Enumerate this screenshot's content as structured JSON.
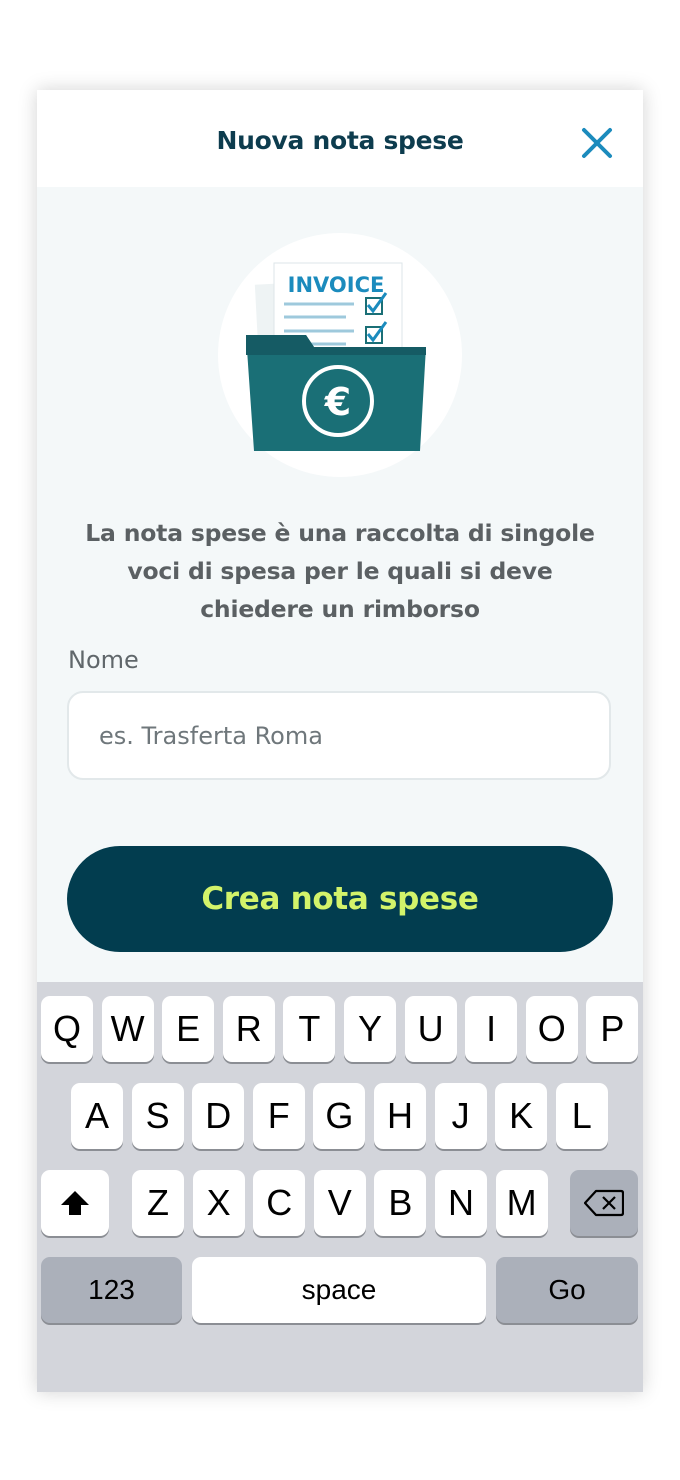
{
  "header": {
    "title": "Nuova nota spese",
    "close_icon": "close-icon"
  },
  "illustration": {
    "doc_title": "INVOICE",
    "currency_symbol": "€",
    "icon": "invoice-folder-illustration"
  },
  "description": "La nota spese è una raccolta di singole voci di spesa per le quali si deve chiedere un rimborso",
  "form": {
    "name_label": "Nome",
    "name_placeholder": "es. Trasferta Roma",
    "name_value": ""
  },
  "create_button": {
    "label": "Crea nota spese"
  },
  "keyboard": {
    "row1": [
      "Q",
      "W",
      "E",
      "R",
      "T",
      "Y",
      "U",
      "I",
      "O",
      "P"
    ],
    "row2": [
      "A",
      "S",
      "D",
      "F",
      "G",
      "H",
      "J",
      "K",
      "L"
    ],
    "row3": [
      "Z",
      "X",
      "C",
      "V",
      "B",
      "N",
      "M"
    ],
    "shift_icon": "shift-icon",
    "backspace_icon": "backspace-icon",
    "numbers_label": "123",
    "space_label": "space",
    "go_label": "Go"
  },
  "colors": {
    "brand_dark": "#023d4f",
    "accent_lime": "#d3f36a",
    "close_blue": "#1b8bbd",
    "folder_teal": "#1a6f76"
  }
}
